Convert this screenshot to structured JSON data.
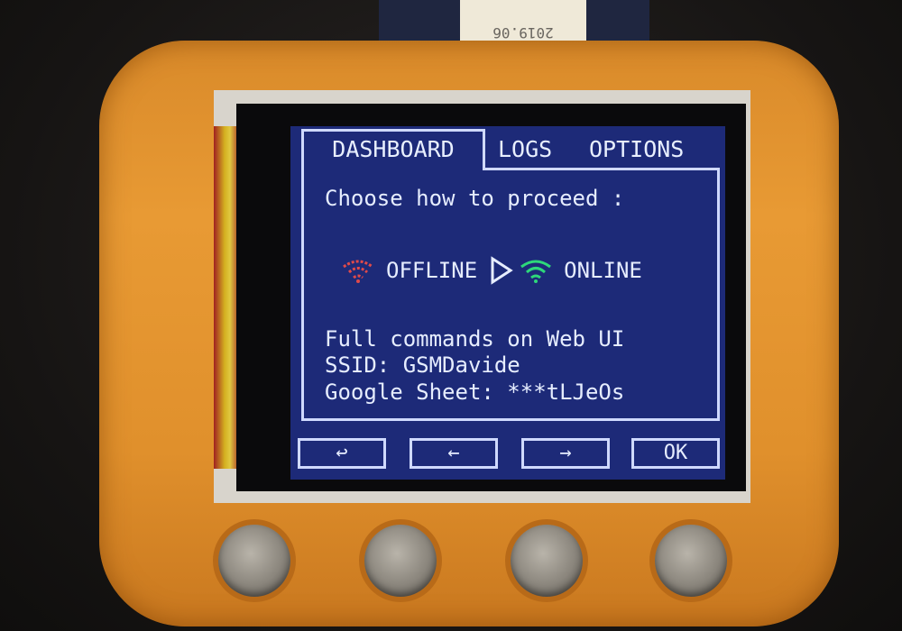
{
  "sticker": {
    "text": "2019.06"
  },
  "tabs": [
    {
      "label": "DASHBOARD",
      "active": true
    },
    {
      "label": "LOGS",
      "active": false
    },
    {
      "label": "OPTIONS",
      "active": false
    }
  ],
  "main": {
    "prompt": "Choose how to proceed :",
    "offline_label": "OFFLINE",
    "online_label": "ONLINE",
    "info_line_1": "Full commands on Web UI",
    "info_line_2": "SSID: GSMDavide",
    "info_line_3": "Google Sheet: ***tLJeOs"
  },
  "softkeys": {
    "back": "↩",
    "left": "←",
    "right": "→",
    "ok": "OK"
  },
  "icons": {
    "offline": "wifi-icon",
    "online": "wifi-icon",
    "proceed": "play-outline-icon"
  },
  "colors": {
    "screen_bg": "#1d2a78",
    "offline": "#e04a4a",
    "online": "#2ed87a",
    "case": "#e0902c"
  }
}
